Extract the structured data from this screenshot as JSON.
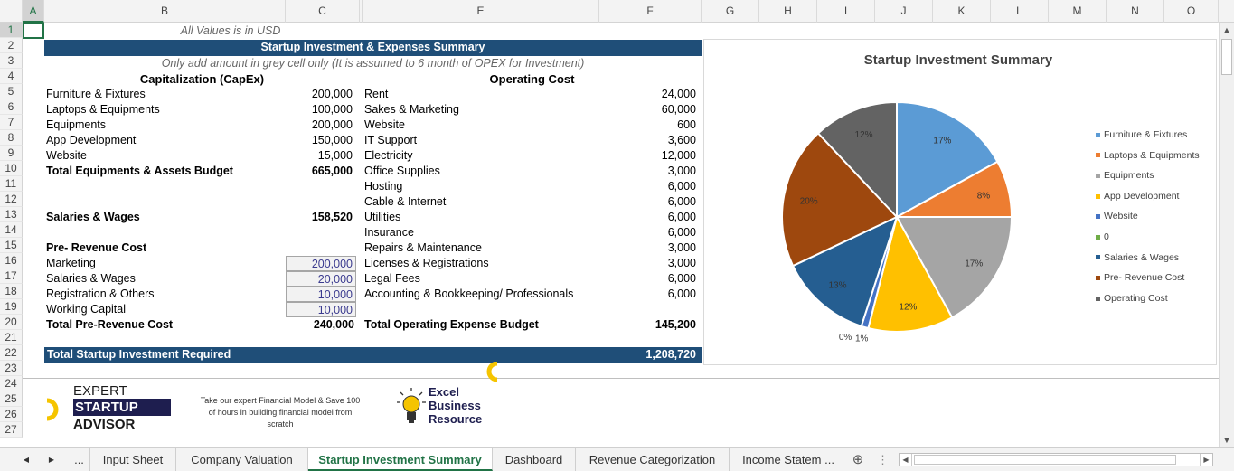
{
  "columns": [
    "A",
    "B",
    "C",
    "D",
    "E",
    "F",
    "G",
    "H",
    "I",
    "J",
    "K",
    "L",
    "M",
    "N",
    "O"
  ],
  "rows": [
    "1",
    "2",
    "3",
    "4",
    "5",
    "6",
    "7",
    "8",
    "9",
    "10",
    "11",
    "12",
    "13",
    "14",
    "15",
    "16",
    "17",
    "18",
    "19",
    "20",
    "21",
    "22",
    "23",
    "24",
    "25",
    "26",
    "27"
  ],
  "sheet": {
    "usd_note": "All Values is in USD",
    "title": "Startup Investment & Expenses Summary",
    "subtitle": "Only add amount in grey cell only (It is assumed to 6 month of OPEX for Investment)",
    "capex_header": "Capitalization (CapEx)",
    "opex_header": "Operating Cost",
    "capex_items": [
      {
        "label": "Furniture & Fixtures",
        "value": "200,000"
      },
      {
        "label": "Laptops & Equipments",
        "value": "100,000"
      },
      {
        "label": "Equipments",
        "value": "200,000"
      },
      {
        "label": "App Development",
        "value": "150,000"
      },
      {
        "label": "Website",
        "value": "15,000"
      }
    ],
    "capex_total_label": "Total Equipments & Assets Budget",
    "capex_total_value": "665,000",
    "salaries_label": "Salaries & Wages",
    "salaries_value": "158,520",
    "prerevenue_header": "Pre- Revenue Cost",
    "prerevenue_items": [
      {
        "label": "Marketing",
        "value": "200,000"
      },
      {
        "label": "Salaries & Wages",
        "value": "20,000"
      },
      {
        "label": "Registration & Others",
        "value": "10,000"
      },
      {
        "label": "Working Capital",
        "value": "10,000"
      }
    ],
    "prerevenue_total_label": "Total Pre-Revenue Cost",
    "prerevenue_total_value": "240,000",
    "opex_items": [
      {
        "label": "Rent",
        "value": "24,000"
      },
      {
        "label": "Sakes & Marketing",
        "value": "60,000"
      },
      {
        "label": "Website",
        "value": "600"
      },
      {
        "label": "IT Support",
        "value": "3,600"
      },
      {
        "label": "Electricity",
        "value": "12,000"
      },
      {
        "label": "Office Supplies",
        "value": "3,000"
      },
      {
        "label": "Hosting",
        "value": "6,000"
      },
      {
        "label": "Cable & Internet",
        "value": "6,000"
      },
      {
        "label": "Utilities",
        "value": "6,000"
      },
      {
        "label": "Insurance",
        "value": "6,000"
      },
      {
        "label": "Repairs & Maintenance",
        "value": "3,000"
      },
      {
        "label": "Licenses & Registrations",
        "value": "3,000"
      },
      {
        "label": "Legal Fees",
        "value": "6,000"
      },
      {
        "label": "Accounting & Bookkeeping/ Professionals",
        "value": "6,000"
      }
    ],
    "opex_total_label": "Total Operating Expense Budget",
    "opex_total_value": "145,200",
    "grand_total_label": "Total Startup Investment Required",
    "grand_total_value": "1,208,720"
  },
  "branding": {
    "expert": "EXPERT",
    "startup": "STARTUP",
    "advisor": "ADVISOR",
    "tagline_1": "Take our expert Financial Model & Save 100",
    "tagline_2": "of hours in building financial model from",
    "tagline_3": "scratch",
    "ebr_1": "Excel",
    "ebr_2": "Business",
    "ebr_3": "Resource"
  },
  "chart_data": {
    "type": "pie",
    "title": "Startup Investment Summary",
    "categories": [
      "Furniture & Fixtures",
      "Laptops & Equipments",
      "Equipments",
      "App Development",
      "Website",
      "0",
      "Salaries & Wages",
      "Pre- Revenue Cost",
      "Operating Cost"
    ],
    "values": [
      17,
      8,
      17,
      12,
      1,
      0,
      13,
      20,
      12
    ],
    "data_labels": [
      "17%",
      "8%",
      "17%",
      "12%",
      "1%",
      "0%",
      "13%",
      "20%",
      "12%"
    ],
    "colors": [
      "#5b9bd5",
      "#ed7d31",
      "#a5a5a5",
      "#ffc000",
      "#4472c4",
      "#70ad47",
      "#255e91",
      "#9e480e",
      "#636363"
    ],
    "legend_position": "right"
  },
  "tabs": [
    {
      "label": "Input Sheet",
      "active": false
    },
    {
      "label": "Company Valuation",
      "active": false
    },
    {
      "label": "Startup Investment Summary",
      "active": true
    },
    {
      "label": "Dashboard",
      "active": false
    },
    {
      "label": "Revenue Categorization",
      "active": false
    },
    {
      "label": "Income Statem ...",
      "active": false
    }
  ],
  "tab_nav": {
    "prev": "◀",
    "next": "▶",
    "more": "...",
    "add": "⊕",
    "options": "⋮"
  }
}
